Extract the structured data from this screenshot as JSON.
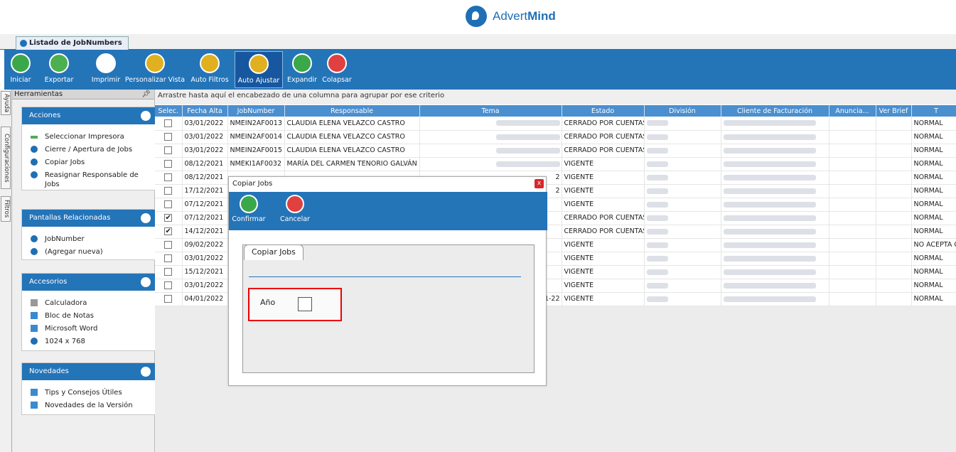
{
  "brand": {
    "name_a": "Advert",
    "name_b": "Mind"
  },
  "window_tab": "Listado de JobNumbers",
  "toolbar": [
    {
      "label": "Iniciar",
      "icon": "play-icon",
      "color": "#3aa84a"
    },
    {
      "label": "Exportar",
      "icon": "export-icon",
      "color": "#4caf50"
    },
    {
      "label": "Imprimir",
      "icon": "printer-icon",
      "color": "#ffffff"
    },
    {
      "label": "Personalizar Vista",
      "icon": "globe-grid-icon",
      "color": "#e0b020"
    },
    {
      "label": "Auto Filtros",
      "icon": "filter-icon",
      "color": "#e0b020"
    },
    {
      "label": "Auto Ajustar",
      "icon": "auto-fit-icon",
      "color": "#e0b020"
    },
    {
      "label": "Expandir",
      "icon": "expand-icon",
      "color": "#3aa84a"
    },
    {
      "label": "Colapsar",
      "icon": "collapse-icon",
      "color": "#e04040"
    }
  ],
  "side_tabs": [
    "Ayuda",
    "Configuraciones",
    "Filtros"
  ],
  "tools": {
    "header": "Herramientas",
    "groups": [
      {
        "title": "Acciones",
        "items": [
          "Seleccionar Impresora",
          "Cierre / Apertura de Jobs",
          "Copiar Jobs",
          "Reasignar Responsable de Jobs"
        ]
      },
      {
        "title": "Pantallas Relacionadas",
        "items": [
          "JobNumber",
          "(Agregar nueva)"
        ]
      },
      {
        "title": "Accesorios",
        "items": [
          "Calculadora",
          "Bloc de Notas",
          "Microsoft Word",
          "1024 x 768"
        ]
      },
      {
        "title": "Novedades",
        "items": [
          "Tips y Consejos Útiles",
          "Novedades de la Versión"
        ]
      }
    ]
  },
  "group_hint": "Arrastre hasta aquí el encabezado de una columna para agrupar por ese criterio",
  "columns": [
    "Selec.",
    "Fecha Alta",
    "JobNumber",
    "Responsable",
    "Tema",
    "Estado",
    "División",
    "Cliente de Facturación",
    "Anuncia...",
    "Ver Brief",
    "T"
  ],
  "rows": [
    {
      "sel": "",
      "fecha": "03/01/2022",
      "job": "NMEIN2AF0013",
      "resp": "CLAUDIA ELENA VELAZCO CASTRO",
      "tema_tail": "",
      "estado": "CERRADO POR CUENTAS",
      "t": "NORMAL"
    },
    {
      "sel": "",
      "fecha": "03/01/2022",
      "job": "NMEIN2AF0014",
      "resp": "CLAUDIA ELENA VELAZCO CASTRO",
      "tema_tail": "",
      "estado": "CERRADO POR CUENTAS",
      "t": "NORMAL"
    },
    {
      "sel": "",
      "fecha": "03/01/2022",
      "job": "NMEIN2AF0015",
      "resp": "CLAUDIA ELENA VELAZCO CASTRO",
      "tema_tail": "",
      "estado": "CERRADO POR CUENTAS",
      "t": "NORMAL"
    },
    {
      "sel": "",
      "fecha": "08/12/2021",
      "job": "NMEKI1AF0032",
      "resp": "MARÍA DEL CARMEN TENORIO GALVÁN",
      "tema_tail": "",
      "estado": "VIGENTE",
      "t": "NORMAL"
    },
    {
      "sel": "",
      "fecha": "08/12/2021",
      "job": "",
      "resp": "",
      "tema_tail": "2",
      "estado": "VIGENTE",
      "t": "NORMAL"
    },
    {
      "sel": "",
      "fecha": "17/12/2021",
      "job": "",
      "resp": "",
      "tema_tail": "2",
      "estado": "VIGENTE",
      "t": "NORMAL"
    },
    {
      "sel": "",
      "fecha": "07/12/2021",
      "job": "",
      "resp": "",
      "tema_tail": "",
      "estado": "VIGENTE",
      "t": "NORMAL"
    },
    {
      "sel": "✔",
      "fecha": "07/12/2021",
      "job": "",
      "resp": "",
      "tema_tail": "",
      "estado": "CERRADO POR CUENTAS",
      "t": "NORMAL"
    },
    {
      "sel": "✔",
      "fecha": "14/12/2021",
      "job": "",
      "resp": "",
      "tema_tail": "",
      "estado": "CERRADO POR CUENTAS",
      "t": "NORMAL"
    },
    {
      "sel": "",
      "fecha": "09/02/2022",
      "job": "",
      "resp": "",
      "tema_tail": "",
      "estado": "VIGENTE",
      "t": "NO ACEPTA C."
    },
    {
      "sel": "",
      "fecha": "03/01/2022",
      "job": "",
      "resp": "",
      "tema_tail": "",
      "estado": "VIGENTE",
      "t": "NORMAL"
    },
    {
      "sel": "",
      "fecha": "15/12/2021",
      "job": "",
      "resp": "",
      "tema_tail": "",
      "estado": "VIGENTE",
      "t": "NORMAL"
    },
    {
      "sel": "",
      "fecha": "03/01/2022",
      "job": "",
      "resp": "",
      "tema_tail": "",
      "estado": "VIGENTE",
      "t": "NORMAL"
    },
    {
      "sel": "",
      "fecha": "04/01/2022",
      "job": "",
      "resp": "",
      "tema_tail": "1-22",
      "estado": "VIGENTE",
      "t": "NORMAL"
    }
  ],
  "dialog": {
    "title": "Copiar Jobs",
    "close": "x",
    "confirm": "Confirmar",
    "cancel": "Cancelar",
    "tab": "Copiar Jobs",
    "year_label": "Año"
  }
}
